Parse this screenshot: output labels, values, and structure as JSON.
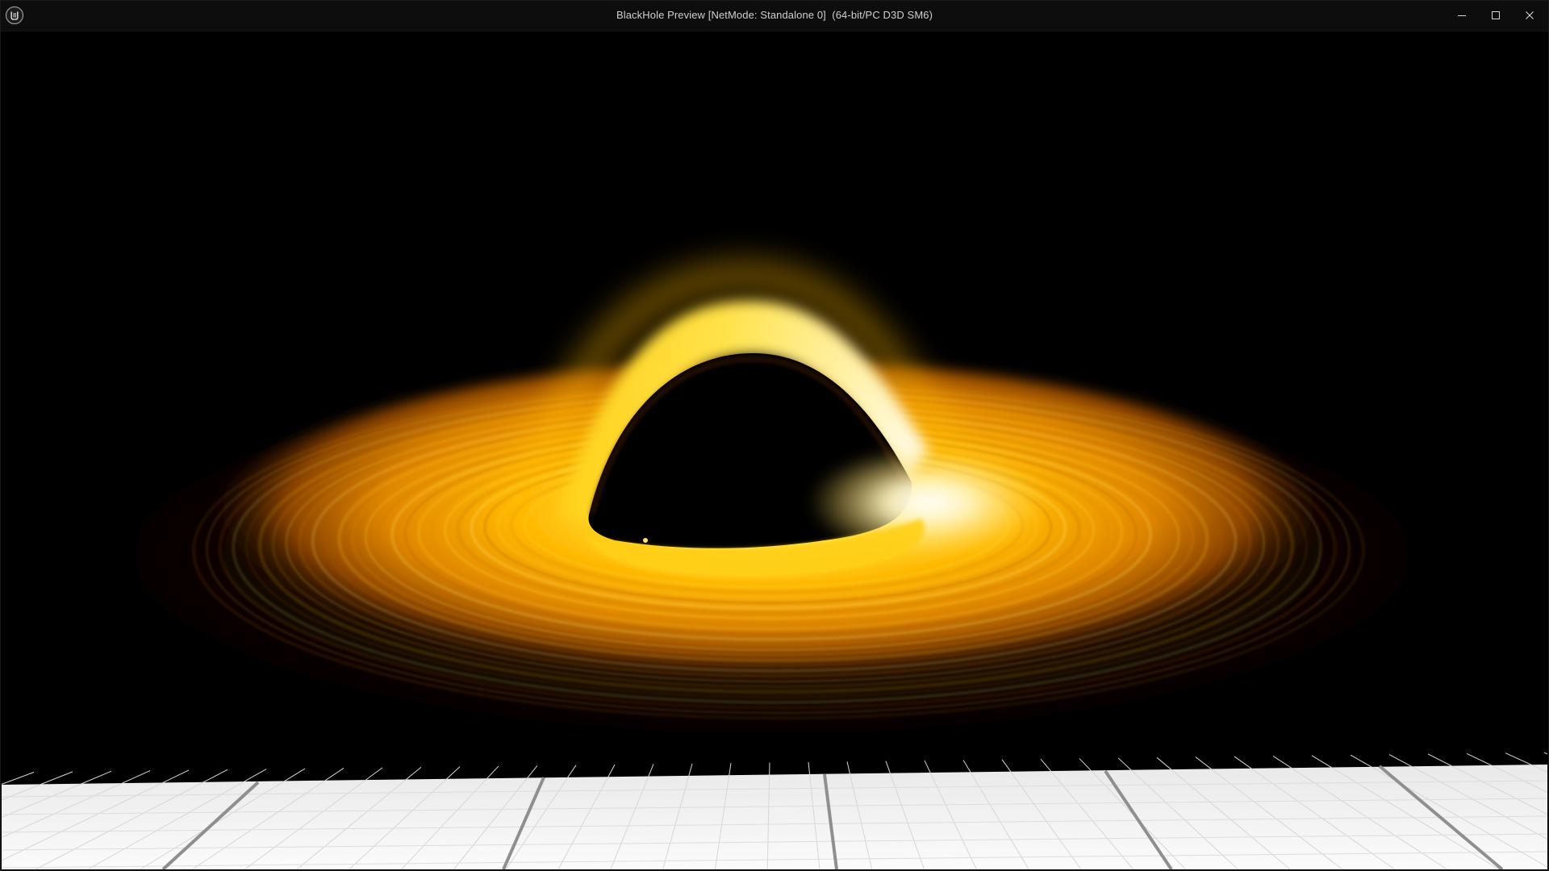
{
  "window": {
    "title": "BlackHole Preview [NetMode: Standalone 0]  (64-bit/PC D3D SM6)",
    "app_icon": "unreal-engine-logo-icon",
    "controls": {
      "minimize_icon": "minimize-icon",
      "maximize_icon": "maximize-icon",
      "close_icon": "close-icon"
    }
  },
  "scene": {
    "subject": "black-hole-with-accretion-disk",
    "floor": "white-grid-floor",
    "colors": {
      "background": "#000000",
      "disk_core": "#fff6c8",
      "disk_bright": "#ffd21a",
      "disk_mid": "#f2a400",
      "disk_outer": "#7a3a00",
      "floor": "#f2f2f2",
      "floor_lines": "#8a8a8a"
    }
  }
}
